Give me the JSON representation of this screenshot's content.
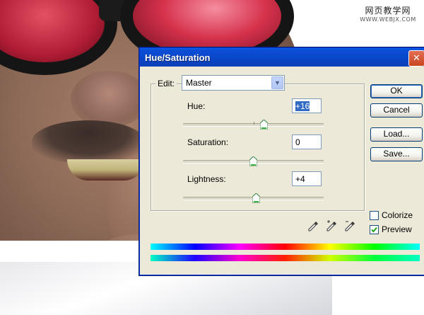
{
  "watermark": {
    "site_cn": "网页教学网",
    "site_url": "WWW.WEBJX.COM"
  },
  "dialog": {
    "title": "Hue/Saturation",
    "close_glyph": "✕",
    "edit": {
      "label": "Edit:",
      "selected": "Master"
    },
    "fields": {
      "hue": {
        "label": "Hue:",
        "value": "+16",
        "slider_fraction": 0.575
      },
      "saturation": {
        "label": "Saturation:",
        "value": "0",
        "slider_fraction": 0.5
      },
      "lightness": {
        "label": "Lightness:",
        "value": "+4",
        "slider_fraction": 0.52
      }
    },
    "buttons": {
      "ok": "OK",
      "cancel": "Cancel",
      "load": "Load...",
      "save": "Save..."
    },
    "checkboxes": {
      "colorize": {
        "label": "Colorize",
        "checked": false
      },
      "preview": {
        "label": "Preview",
        "checked": true
      }
    },
    "eyedroppers": [
      "eyedropper-icon",
      "eyedropper-plus-icon",
      "eyedropper-minus-icon"
    ]
  }
}
